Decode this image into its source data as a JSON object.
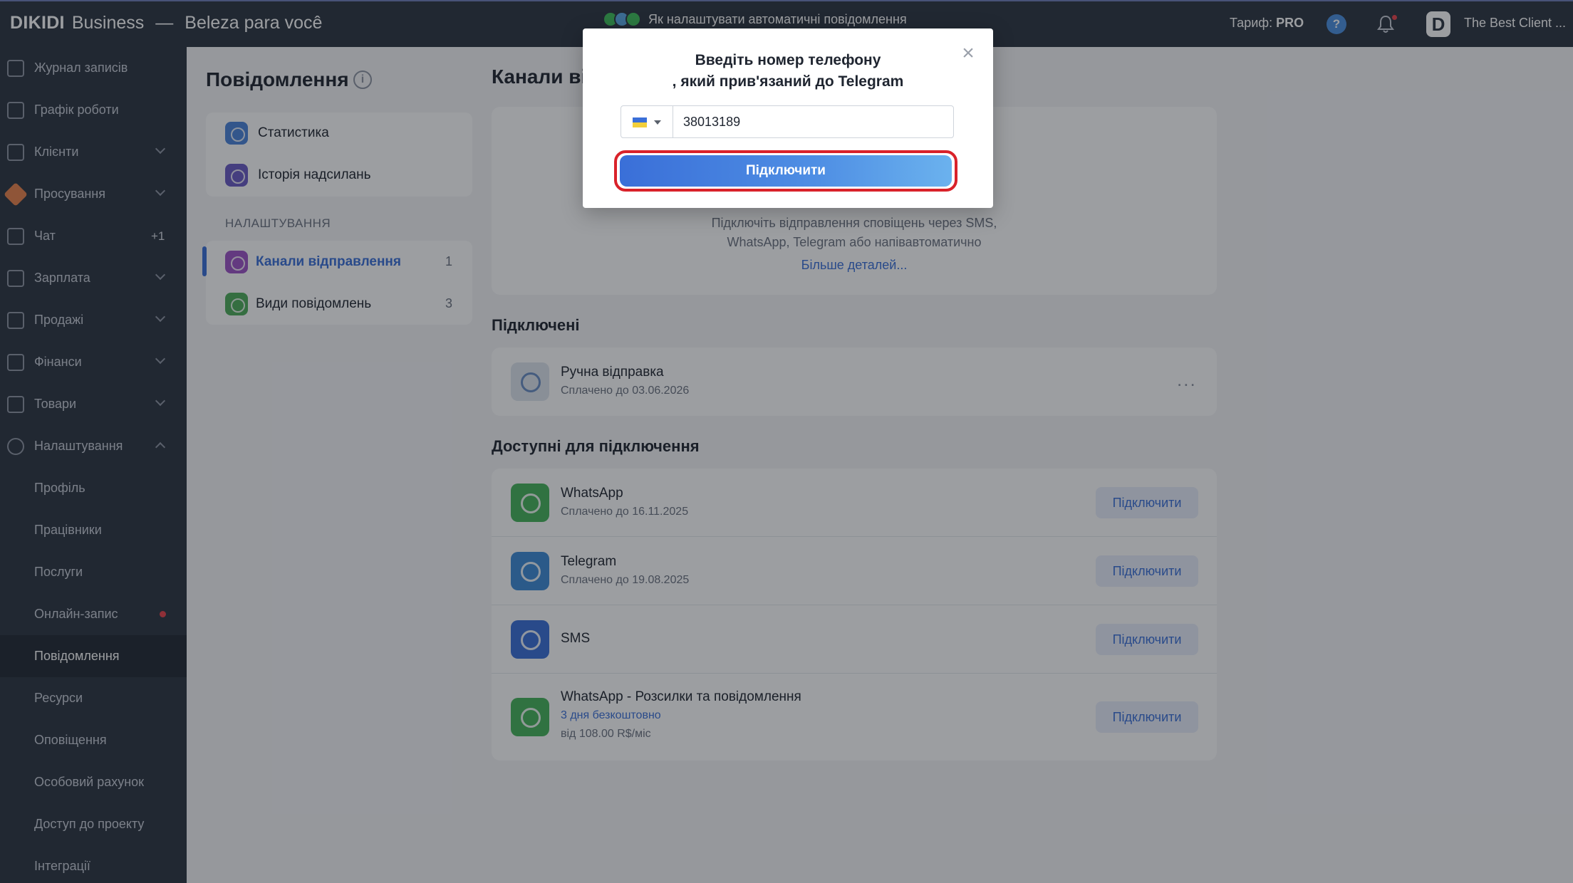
{
  "header": {
    "brand": "DIKIDI",
    "brand_suffix": "Business",
    "dash": "—",
    "salon": "Beleza para você",
    "promo_text": "Як налаштувати автоматичні повідомлення",
    "tariff_label": "Тариф:",
    "tariff_value": "PRO",
    "help_icon": "?",
    "avatar_letter": "D",
    "client_name": "The Best Client ..."
  },
  "sidebar": {
    "items": [
      {
        "label": "Журнал записів"
      },
      {
        "label": "Графік роботи"
      },
      {
        "label": "Клієнти"
      },
      {
        "label": "Просування"
      },
      {
        "label": "Чат",
        "badge": "+1"
      },
      {
        "label": "Зарплата"
      },
      {
        "label": "Продажі"
      },
      {
        "label": "Фінанси"
      },
      {
        "label": "Товари"
      },
      {
        "label": "Налаштування"
      },
      {
        "label": "Профіль"
      },
      {
        "label": "Працівники"
      },
      {
        "label": "Послуги"
      },
      {
        "label": "Онлайн-запис"
      },
      {
        "label": "Повідомлення"
      },
      {
        "label": "Ресурси"
      },
      {
        "label": "Оповіщення"
      },
      {
        "label": "Особовий рахунок"
      },
      {
        "label": "Доступ до проекту"
      },
      {
        "label": "Інтеграції"
      }
    ]
  },
  "left_panel": {
    "title": "Повідомлення",
    "info_icon": "i",
    "menu": [
      {
        "label": "Статистика"
      },
      {
        "label": "Історія надсилань"
      }
    ],
    "section_label": "НАЛАШТУВАННЯ",
    "settings": [
      {
        "label": "Канали відправлення",
        "count": "1"
      },
      {
        "label": "Види повідомлень",
        "count": "3"
      }
    ]
  },
  "content": {
    "title": "Канали відправлення",
    "intro_line1": "Підключіть відправлення сповіщень через SMS,",
    "intro_line2": "WhatsApp, Telegram або напівавтоматично",
    "intro_link": "Більше деталей...",
    "connected_title": "Підключені",
    "connected": [
      {
        "name": "Ручна відправка",
        "sub": "Сплачено до 03.06.2026",
        "more": "..."
      }
    ],
    "available_title": "Доступні для підключення",
    "available": [
      {
        "name": "WhatsApp",
        "sub": "Сплачено до 16.11.2025",
        "button": "Підключити"
      },
      {
        "name": "Telegram",
        "sub": "Сплачено до 19.08.2025",
        "button": "Підключити"
      },
      {
        "name": "SMS",
        "button": "Підключити"
      },
      {
        "name": "WhatsApp - Розсилки та повідомлення",
        "sub_blue": "3 дня безкоштовно",
        "sub": "від 108.00 R$/міс",
        "button": "Підключити"
      }
    ]
  },
  "modal": {
    "title_line1": "Введіть номер телефону",
    "title_line2": ", який прив'язаний до Telegram",
    "close_icon": "×",
    "phone_value": "38013189",
    "connect_button": "Підключити"
  },
  "colors": {
    "accent": "#3a6fd8",
    "highlight_ring": "#d9222a",
    "sidebar_bg": "#2c3440"
  }
}
